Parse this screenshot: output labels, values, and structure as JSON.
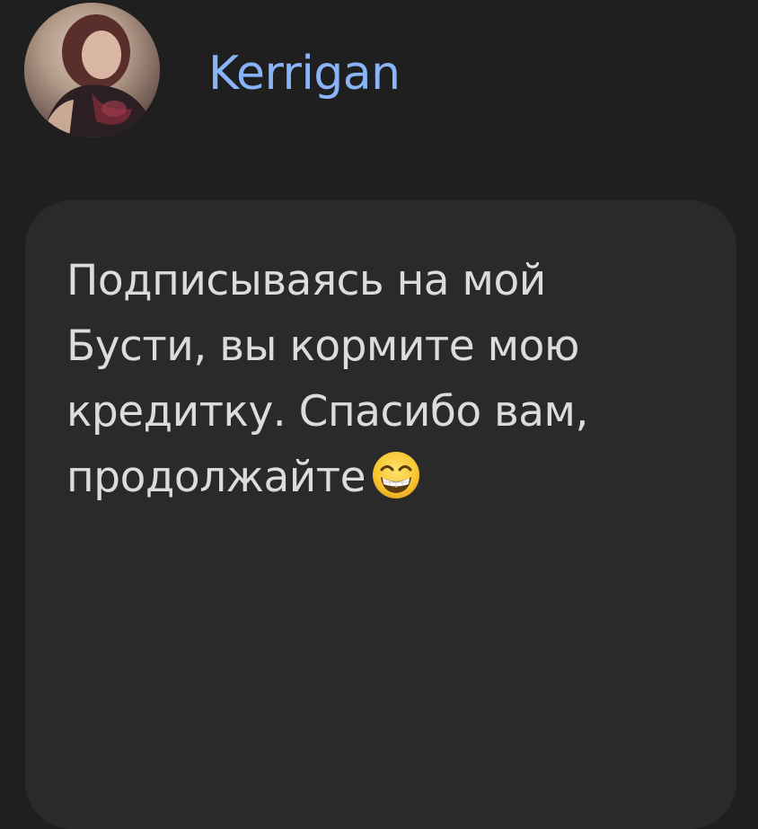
{
  "author": {
    "name": "Kerrigan",
    "avatar_icon": "user-avatar-photo",
    "name_color": "#8ab4f8"
  },
  "message": {
    "text": "Подписываясь на мой Бусти, вы кормите мою кредитку. Спасибо вам, продолжайте",
    "emoji_icon": "grinning-face-with-smiling-eyes-emoji",
    "text_color": "#dcdcdc",
    "bubble_color": "#2a2a2b"
  },
  "background_color": "#1f1f20"
}
